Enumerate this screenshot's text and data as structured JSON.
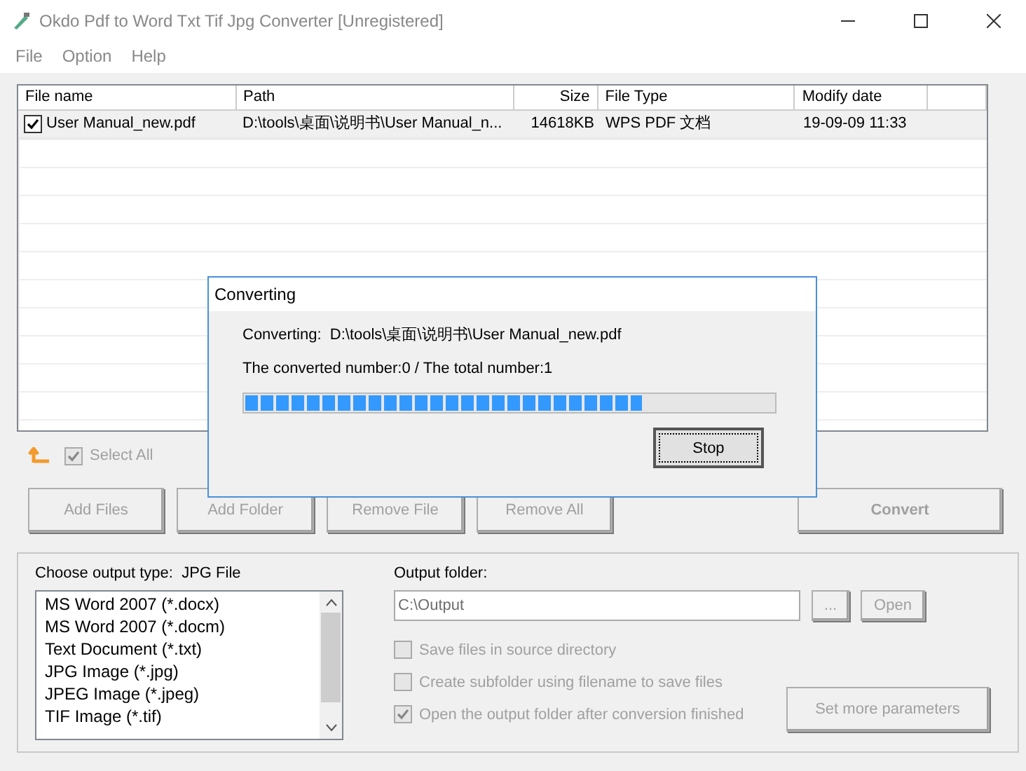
{
  "window": {
    "title": "Okdo Pdf to Word Txt Tif Jpg Converter [Unregistered]"
  },
  "menu": [
    "File",
    "Option",
    "Help"
  ],
  "table": {
    "columns": [
      "File name",
      "Path",
      "Size",
      "File Type",
      "Modify date"
    ],
    "rows": [
      {
        "checked": true,
        "cells": [
          "User Manual_new.pdf",
          "D:\\tools\\桌面\\说明书\\User Manual_n...",
          "14618KB",
          "WPS PDF 文档",
          "19-09-09 11:33"
        ]
      }
    ]
  },
  "select_all": {
    "label": "Select All",
    "checked": true,
    "disabled": true
  },
  "buttons": [
    {
      "label": "Add Files",
      "disabled": true
    },
    {
      "label": "Add Folder",
      "disabled": true
    },
    {
      "label": "Remove File",
      "disabled": true
    },
    {
      "label": "Remove All",
      "disabled": true
    }
  ],
  "convert": {
    "label": "Convert",
    "disabled": true
  },
  "output_type": {
    "label": "Choose output type:",
    "value": "JPG File",
    "items": [
      "MS Word 2007 (*.docx)",
      "MS Word 2007 (*.docm)",
      "Text Document (*.txt)",
      "JPG Image (*.jpg)",
      "JPEG Image (*.jpeg)",
      "TIF Image (*.tif)"
    ]
  },
  "output_folder": {
    "label": "Output folder:",
    "value": "C:\\Output",
    "disabled": true,
    "browse": {
      "label": "...",
      "disabled": true
    },
    "open": {
      "label": "Open",
      "disabled": true
    }
  },
  "options": [
    {
      "label": "Save files in source directory",
      "checked": false,
      "disabled": true
    },
    {
      "label": "Create subfolder using filename to save files",
      "checked": false,
      "disabled": true
    },
    {
      "label": "Open the output folder after conversion finished",
      "checked": true,
      "disabled": true
    }
  ],
  "more_params": {
    "label": "Set more parameters",
    "disabled": true
  },
  "dialog": {
    "title": "Converting",
    "file_label": "Converting:",
    "file": "D:\\tools\\桌面\\说明书\\User Manual_new.pdf",
    "count": "The converted number:0  /  The total number:1",
    "level": 0.75,
    "stop": "Stop"
  }
}
